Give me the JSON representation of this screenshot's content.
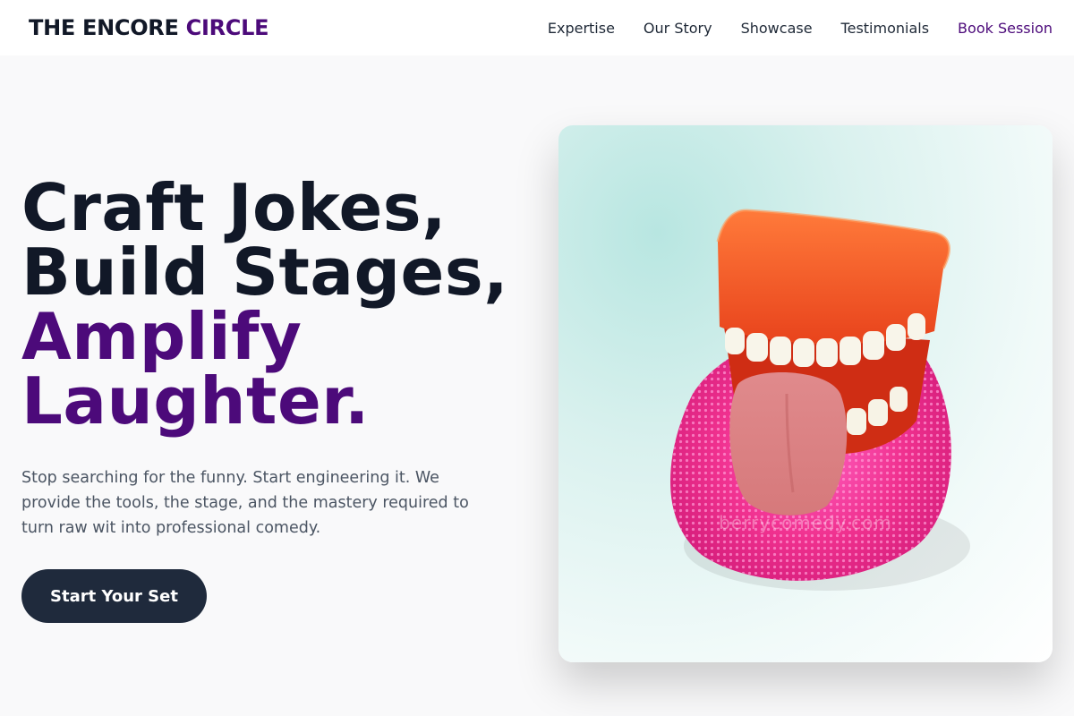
{
  "brand": {
    "name_main": "THE ENCORE",
    "name_accent": "CIRCLE"
  },
  "nav": {
    "items": [
      {
        "label": "Expertise"
      },
      {
        "label": "Our Story"
      },
      {
        "label": "Showcase"
      },
      {
        "label": "Testimonials"
      }
    ],
    "cta_label": "Book Session"
  },
  "hero": {
    "headline_lines": [
      {
        "text": "Craft Jokes,"
      },
      {
        "text": "Build Stages,"
      }
    ],
    "headline_accent_lines": [
      {
        "text": "Amplify"
      },
      {
        "text": "Laughter."
      }
    ],
    "subtext": "Stop searching for the funny. Start engineering it. We provide the tools, the stage, and the mastery required to turn raw wit into professional comedy.",
    "button_label": "Start Your Set",
    "image": {
      "alt": "Wind-up chattering teeth toy with tongue sticking out on a pink scrubber",
      "watermark": "berrycomedy.com"
    }
  },
  "colors": {
    "accent": "#4c0a7a",
    "dark": "#111827",
    "button_bg": "#1f2a3c",
    "page_bg": "#f9f9fa"
  }
}
